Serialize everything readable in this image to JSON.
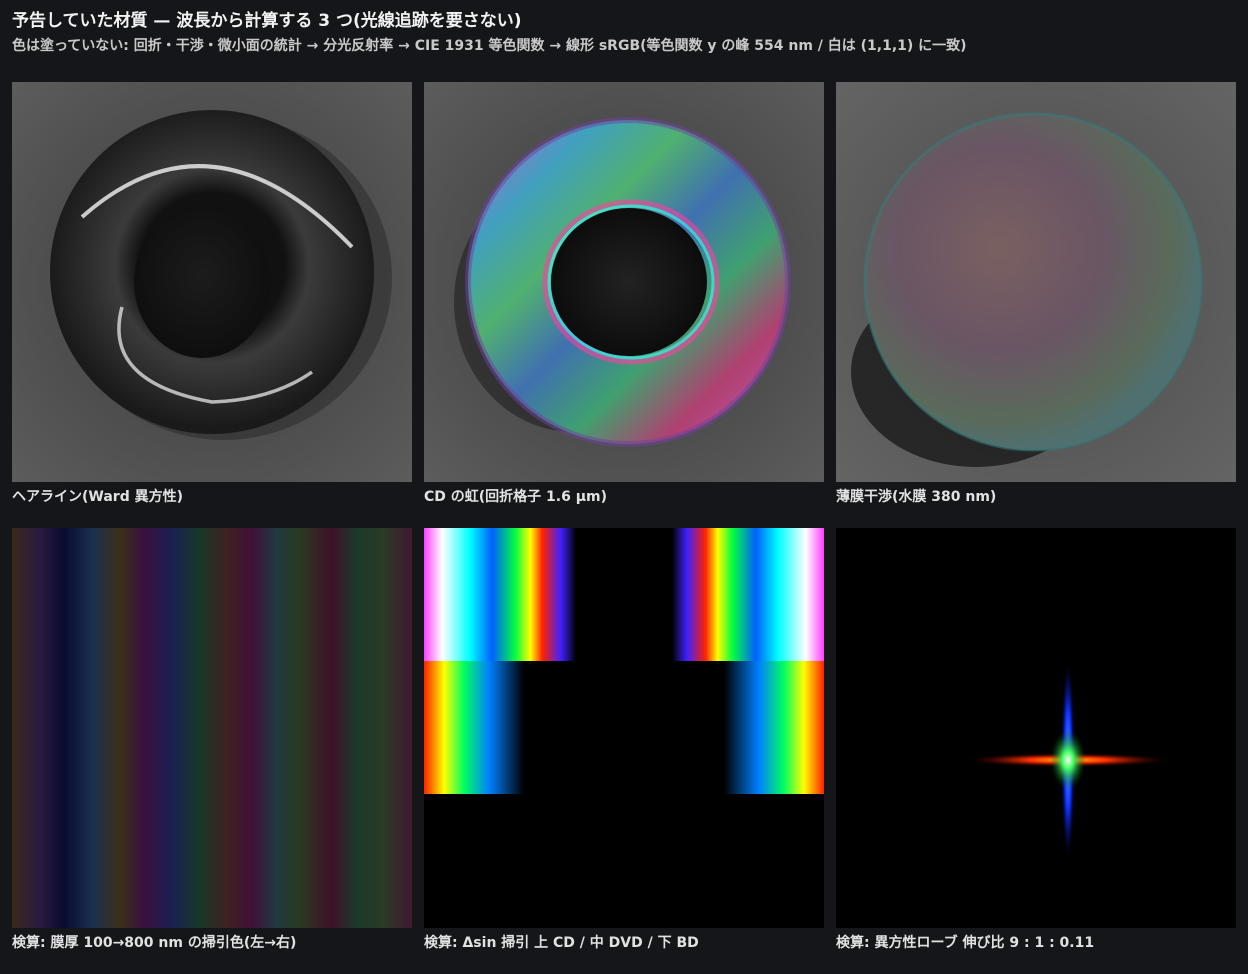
{
  "header": {
    "title": "予告していた材質 — 波長から計算する 3 つ(光線追跡を要さない)",
    "subtitle": "色は塗っていない: 回折・干渉・微小面の統計 → 分光反射率 → CIE 1931 等色関数 → 線形 sRGB(等色関数 y の峰 554 nm / 白は (1,1,1) に一致)"
  },
  "panels": [
    {
      "caption": "ヘアライン(Ward 異方性)"
    },
    {
      "caption": "CD の虹(回折格子 1.6 µm)"
    },
    {
      "caption": "薄膜干渉(水膜 380 nm)"
    },
    {
      "caption": "検算: 膜厚 100→800 nm の掃引色(左→右)"
    },
    {
      "caption": "検算: Δsin 掃引 上 CD / 中 DVD / 下 BD"
    },
    {
      "caption": "検算: 異方性ローブ 伸び比 9 : 1 : 0.11"
    }
  ],
  "colors": {
    "background": "#14161a",
    "panel_bg": "#5a5a5a",
    "spectrum": [
      "#ff3cff",
      "#ffffff",
      "#00ffff",
      "#0080ff",
      "#00ff40",
      "#ffff00",
      "#ff8000",
      "#ff0000"
    ]
  }
}
